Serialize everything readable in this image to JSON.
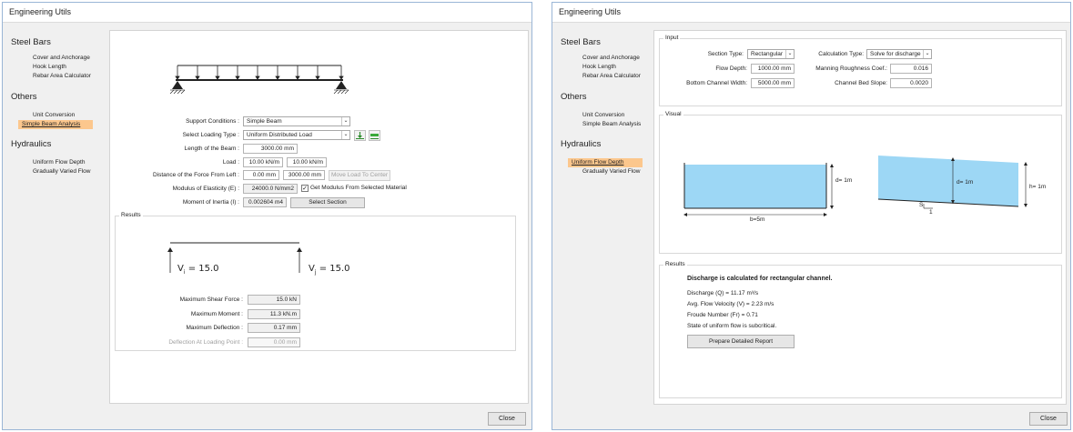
{
  "left_window": {
    "title": "Engineering Utils",
    "sidebar": {
      "steel_bars_title": "Steel Bars",
      "steel_items": [
        "Cover and Anchorage",
        "Hook Length",
        "Rebar Area Calculator"
      ],
      "others_title": "Others",
      "others_items": [
        "Unit Conversion",
        "Simple Beam Analysis"
      ],
      "hydraulics_title": "Hydraulics",
      "hydraulics_items": [
        "Uniform Flow Depth",
        "Gradually Varied Flow"
      ]
    },
    "form": {
      "support_label": "Support Conditions :",
      "support_value": "Simple Beam",
      "loading_label": "Select Loading Type :",
      "loading_value": "Uniform Distributed Load",
      "length_label": "Length of the Beam :",
      "length_value": "3000.00 mm",
      "load_label": "Load :",
      "load_value_1": "10.00 kN/m",
      "load_value_2": "10.00 kN/m",
      "distance_label": "Distance of the Force From Left :",
      "distance_value_1": "0.00 mm",
      "distance_value_2": "3000.00 mm",
      "move_button": "Move Load To Center",
      "modulus_label": "Modulus of Elasticity (E) :",
      "modulus_value": "24000.0 N/mm2",
      "modulus_checkbox": "Get Modulus From Selected Material",
      "modulus_checked": true,
      "inertia_label": "Moment of Inertia (I) :",
      "inertia_value": "0.002604 m4",
      "select_section_button": "Select Section"
    },
    "results": {
      "title": "Results",
      "vi_label": "V",
      "vi_sub": "i",
      "vi_value": "= 15.0",
      "vj_label": "V",
      "vj_sub": "j",
      "vj_value": "= 15.0",
      "max_shear_label": "Maximum Shear Force :",
      "max_shear_value": "15.0 kN",
      "max_moment_label": "Maximum Moment :",
      "max_moment_value": "11.3 kN.m",
      "max_deflection_label": "Maximum Deflection :",
      "max_deflection_value": "0.17 mm",
      "deflection_point_label": "Deflection At Loading Point :",
      "deflection_point_value": "0.00 mm"
    },
    "close_button": "Close"
  },
  "right_window": {
    "title": "Engineering Utils",
    "sidebar": {
      "steel_bars_title": "Steel Bars",
      "steel_items": [
        "Cover and Anchorage",
        "Hook Length",
        "Rebar Area Calculator"
      ],
      "others_title": "Others",
      "others_items": [
        "Unit Conversion",
        "Simple Beam Analysis"
      ],
      "hydraulics_title": "Hydraulics",
      "hydraulics_items": [
        "Uniform Flow Depth",
        "Gradually Varied Flow"
      ]
    },
    "input": {
      "title": "Input",
      "section_type_label": "Section Type:",
      "section_type_value": "Rectangular",
      "calc_type_label": "Calculation Type:",
      "calc_type_value": "Solve for discharge",
      "flow_depth_label": "Flow Depth:",
      "flow_depth_value": "1000.00 mm",
      "manning_label": "Manning Roughness Coef.:",
      "manning_value": "0.016",
      "bottom_width_label": "Bottom Channel Width:",
      "bottom_width_value": "5000.00 mm",
      "bed_slope_label": "Channel Bed Slope:",
      "bed_slope_value": "0.0020"
    },
    "visual": {
      "title": "Visual",
      "depth_label": "d= 1m",
      "width_label": "b=5m",
      "depth_label_2": "d= 1m",
      "h_label": "h= 1m",
      "slope_label": "S",
      "slope_run": "1"
    },
    "results": {
      "title": "Results",
      "headline": "Discharge is calculated for rectangular channel.",
      "discharge": "Discharge (Q) = 11.17 m³/s",
      "velocity": "Avg. Flow Velocity (V) = 2.23 m/s",
      "froude": "Froude Number (Fr) = 0.71",
      "state": "State of uniform flow is subcritical.",
      "report_button": "Prepare Detailed Report"
    },
    "close_button": "Close"
  },
  "colors": {
    "active_nav": "#fcc78d",
    "water": "#9dd7f5",
    "window_border": "#9ab6d6"
  }
}
